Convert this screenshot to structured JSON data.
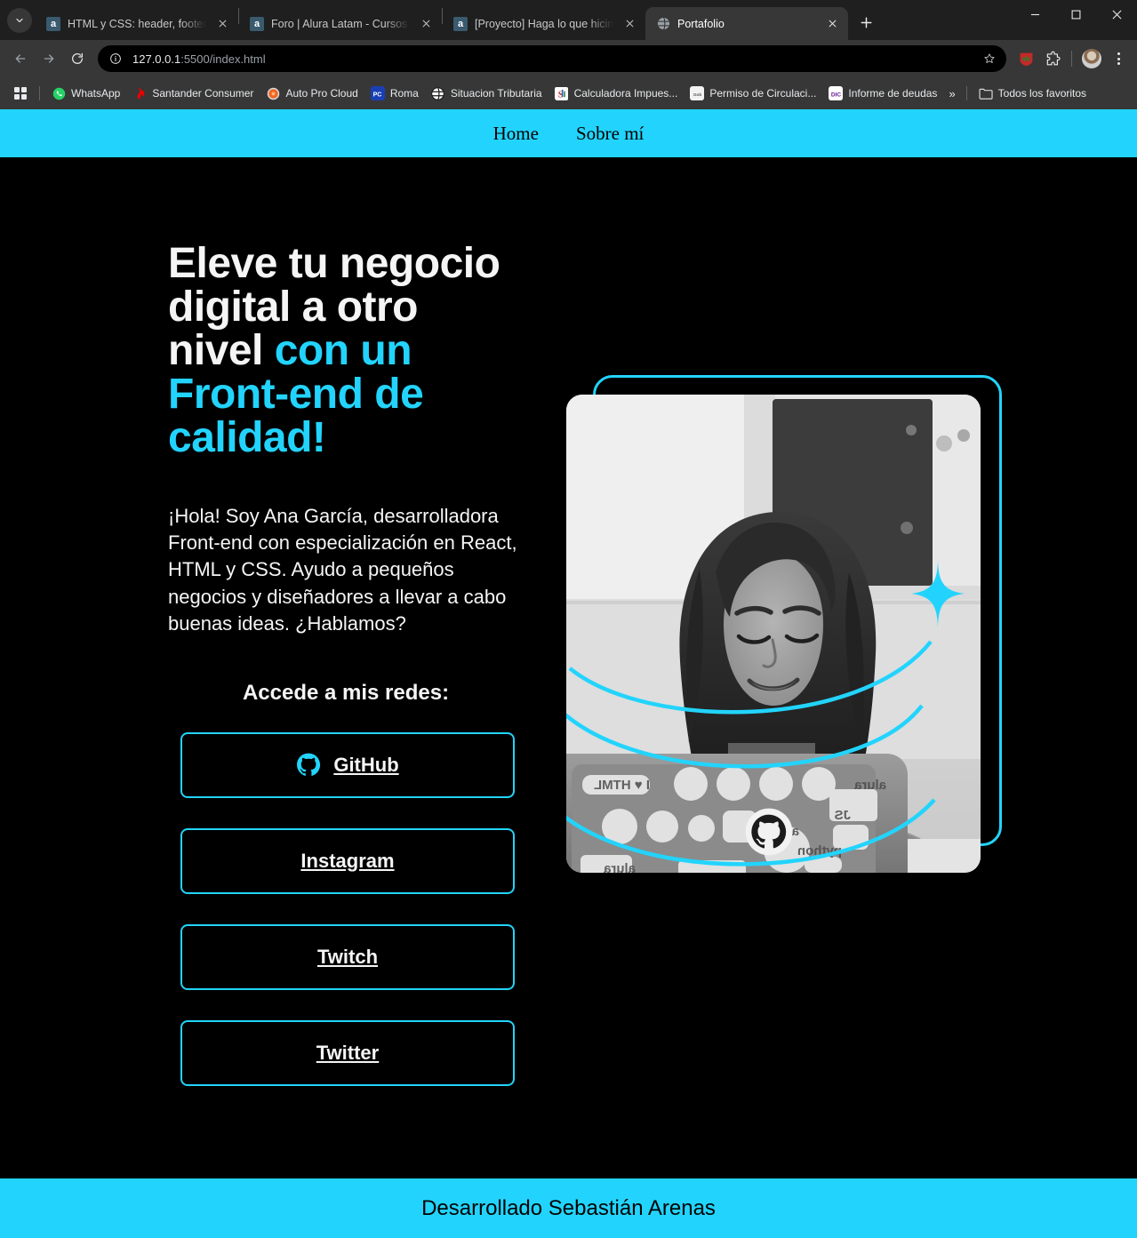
{
  "browser": {
    "tabs": [
      {
        "title": "HTML y CSS: header, footer y va",
        "favicon": "alura-icon",
        "active": false
      },
      {
        "title": "Foro | Alura Latam - Cursos onli",
        "favicon": "alura-icon",
        "active": false
      },
      {
        "title": "[Proyecto] Haga lo que hicimos",
        "favicon": "alura-icon",
        "active": false
      },
      {
        "title": "Portafolio",
        "favicon": "globe-icon",
        "active": true
      }
    ],
    "tab_close_label": "close-tab",
    "new_tab_label": "New Tab",
    "window_controls": {
      "minimize": "minimize",
      "maximize": "maximize",
      "close": "close"
    },
    "nav": {
      "back": "Back",
      "forward": "Forward",
      "reload": "Reload"
    },
    "omnibox": {
      "site_info": "site-information",
      "url_host": "127.0.0.1",
      "url_rest": ":5500/index.html",
      "bookmark_star": "Bookmark this tab"
    },
    "toolbar_icons": [
      "extension-puzzle-icon",
      "profile-avatar",
      "chrome-menu-icon"
    ],
    "bookmarks": {
      "apps_label": "apps-grid-icon",
      "items": [
        {
          "label": "WhatsApp",
          "icon": "whatsapp-icon"
        },
        {
          "label": "Santander Consumer",
          "icon": "santander-icon"
        },
        {
          "label": "Auto Pro Cloud",
          "icon": "autoprocloud-icon"
        },
        {
          "label": "Roma",
          "icon": "roma-icon"
        },
        {
          "label": "Situacion Tributaria",
          "icon": "sii-globe-icon"
        },
        {
          "label": "Calculadora Impues...",
          "icon": "sii-icon"
        },
        {
          "label": "Permiso de Circulaci...",
          "icon": "permiso-icon"
        },
        {
          "label": "Informe de deudas",
          "icon": "informe-icon"
        }
      ],
      "overflow_label": "»",
      "all_bookmarks_label": "Todos los favoritos",
      "all_bookmarks_icon": "folder-icon"
    }
  },
  "site": {
    "nav": {
      "items": [
        {
          "label": "Home"
        },
        {
          "label": "Sobre mí"
        }
      ]
    },
    "hero": {
      "title_plain": "Eleve tu negocio digital a otro nivel ",
      "title_accent": "con un Front-end de calidad!",
      "paragraph": "¡Hola! Soy Ana García, desarrolladora Front-end con especialización en React, HTML y CSS. Ayudo a pequeños negocios y diseñadores a llevar a cabo buenas ideas. ¿Hablamos?",
      "redes_title": "Accede a mis redes:",
      "buttons": [
        {
          "label": "GitHub",
          "icon": "github-icon"
        },
        {
          "label": "Instagram",
          "icon": ""
        },
        {
          "label": "Twitch",
          "icon": ""
        },
        {
          "label": "Twitter",
          "icon": ""
        }
      ],
      "photo_alt": "profile-photo-woman-at-laptop"
    },
    "footer": {
      "text": "Desarrollado Sebastián Arenas"
    },
    "colors": {
      "accent": "#22D4FD",
      "background": "#000000",
      "text": "#F5F5F5",
      "footer_text": "#000000"
    }
  }
}
